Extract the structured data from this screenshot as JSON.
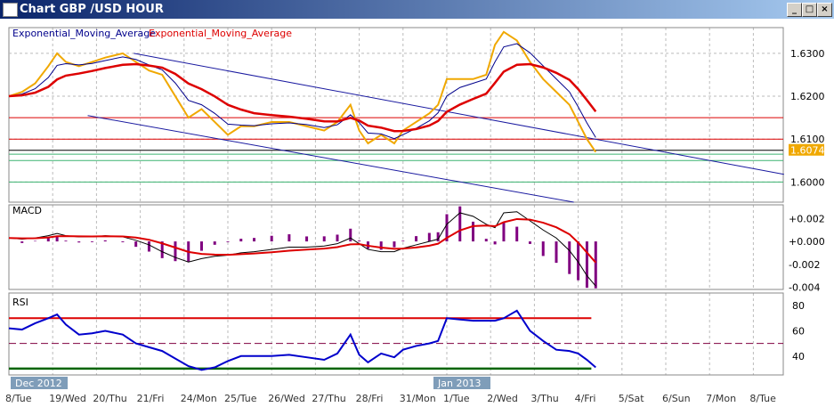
{
  "window": {
    "title": "Chart GBP /USD  HOUR",
    "min": "_",
    "max": "□",
    "close": "×"
  },
  "colors": {
    "price": "#f0a800",
    "ema_fast": "#00008b",
    "ema_slow": "#dd0000",
    "macd_hist": "#800080",
    "rsi": "#0000cc"
  },
  "chart_data": [
    {
      "type": "line",
      "title": "GBP/USD HOUR",
      "legend": [
        "Exponential_Moving_Average",
        "Exponential_Moving_Average"
      ],
      "yticks": [
        "1.6300",
        "1.6200",
        "1.6100",
        "1.6000"
      ],
      "ylim": [
        1.5953,
        1.636
      ],
      "last_price": "1.6074",
      "x": [
        0,
        0.3,
        0.6,
        0.9,
        1.1,
        1.3,
        1.6,
        1.9,
        2.2,
        2.6,
        2.9,
        3.2,
        3.5,
        3.8,
        4.1,
        4.4,
        4.7,
        5.0,
        5.3,
        5.6,
        6.0,
        6.4,
        6.8,
        7.2,
        7.5,
        7.8,
        8.0,
        8.2,
        8.5,
        8.8,
        9.0,
        9.3,
        9.6,
        9.8,
        10.0,
        10.3,
        10.6,
        10.9,
        11.1,
        11.3,
        11.6,
        11.9,
        12.2,
        12.5,
        12.8,
        13.0,
        13.2,
        13.4
      ],
      "price": [
        1.62,
        1.621,
        1.623,
        1.627,
        1.63,
        1.628,
        1.627,
        1.628,
        1.629,
        1.63,
        1.628,
        1.626,
        1.625,
        1.62,
        1.615,
        1.617,
        1.614,
        1.611,
        1.613,
        1.613,
        1.614,
        1.614,
        1.613,
        1.612,
        1.614,
        1.618,
        1.612,
        1.609,
        1.611,
        1.609,
        1.612,
        1.614,
        1.616,
        1.618,
        1.624,
        1.624,
        1.624,
        1.625,
        1.632,
        1.635,
        1.633,
        1.628,
        1.624,
        1.621,
        1.618,
        1.614,
        1.61,
        1.607
      ],
      "levels": [
        {
          "v": 1.615,
          "c": "#dd0000"
        },
        {
          "v": 1.61,
          "c": "#dd0000"
        },
        {
          "v": 1.6074,
          "c": "#000000"
        },
        {
          "v": 1.6065,
          "c": "#3cb371"
        },
        {
          "v": 1.605,
          "c": "#3cb371"
        },
        {
          "v": 1.6,
          "c": "#3cb371"
        }
      ],
      "channel": [
        [
          [
            2.85,
            1.63
          ],
          [
            17.7,
            1.6018
          ]
        ],
        [
          [
            1.8,
            1.6155
          ],
          [
            12.9,
            1.5953
          ]
        ]
      ]
    },
    {
      "type": "line",
      "title": "MACD",
      "yticks": [
        "+0.002",
        "+0.000",
        "-0.002",
        "-0.004"
      ],
      "ylim": [
        -0.0042,
        0.0032
      ],
      "macd": [
        0.0003,
        0.0002,
        0.0003,
        0.0005,
        0.0007,
        0.0005,
        0.0004,
        0.0004,
        0.0005,
        0.0004,
        0.0001,
        -0.0003,
        -0.0009,
        -0.0014,
        -0.0018,
        -0.0015,
        -0.0013,
        -0.0012,
        -0.001,
        -0.0009,
        -0.0007,
        -0.0005,
        -0.0005,
        -0.0004,
        -0.0002,
        0.0003,
        -0.0002,
        -0.0007,
        -0.0009,
        -0.0009,
        -0.0006,
        -0.0003,
        0.0,
        0.0002,
        0.0015,
        0.0025,
        0.0022,
        0.0015,
        0.0012,
        0.0025,
        0.0026,
        0.0018,
        0.001,
        0.0003,
        -0.0008,
        -0.0018,
        -0.003,
        -0.0039
      ]
    },
    {
      "type": "line",
      "title": "RSI",
      "yticks": [
        "80",
        "60",
        "40"
      ],
      "ylim": [
        25,
        90
      ],
      "levels": [
        70,
        50,
        30
      ],
      "rsi": [
        62,
        61,
        66,
        70,
        73,
        65,
        57,
        58,
        60,
        57,
        50,
        47,
        44,
        38,
        32,
        29,
        31,
        36,
        40,
        40,
        40,
        41,
        39,
        37,
        42,
        57,
        41,
        35,
        42,
        39,
        45,
        48,
        50,
        52,
        70,
        69,
        68,
        68,
        68,
        70,
        76,
        60,
        52,
        45,
        44,
        42,
        37,
        31
      ]
    },
    {
      "xticks": [
        "8/Tue",
        "19/Wed",
        "20/Thu",
        "21/Fri",
        "24/Mon",
        "25/Tue",
        "26/Wed",
        "27/Thu",
        "28/Fri",
        "31/Mon",
        "1/Tue",
        "2/Wed",
        "3/Thu",
        "4/Fri",
        "5/Sat",
        "6/Sun",
        "7/Mon",
        "8/Tue"
      ],
      "period_labels": [
        "Dec 2012",
        "Jan 2013"
      ]
    }
  ]
}
